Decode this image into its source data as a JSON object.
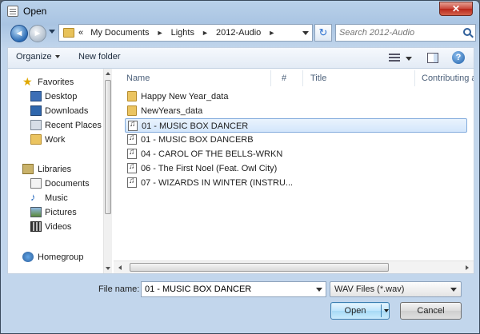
{
  "window": {
    "title": "Open",
    "close_label": "✕"
  },
  "nav": {
    "back_glyph": "◄",
    "forward_glyph": "►",
    "breadcrumb": [
      "«",
      "My Documents",
      "Lights",
      "2012-Audio"
    ],
    "breadcrumb_separator": "►",
    "refresh_glyph": "↻",
    "search_placeholder": "Search 2012-Audio"
  },
  "toolbar": {
    "organize_label": "Organize",
    "new_folder_label": "New folder",
    "help_glyph": "?"
  },
  "sidebar": {
    "items": [
      {
        "label": "Favorites",
        "icon": "star-icon",
        "level": 0
      },
      {
        "label": "Desktop",
        "icon": "desktop-icon",
        "level": 1
      },
      {
        "label": "Downloads",
        "icon": "downloads-icon",
        "level": 1
      },
      {
        "label": "Recent Places",
        "icon": "recent-places-icon",
        "level": 1
      },
      {
        "label": "Work",
        "icon": "folder-icon",
        "level": 1
      },
      {
        "label": "Libraries",
        "icon": "libraries-icon",
        "level": 0
      },
      {
        "label": "Documents",
        "icon": "documents-icon",
        "level": 1
      },
      {
        "label": "Music",
        "icon": "music-icon",
        "level": 1
      },
      {
        "label": "Pictures",
        "icon": "pictures-icon",
        "level": 1
      },
      {
        "label": "Videos",
        "icon": "videos-icon",
        "level": 1
      },
      {
        "label": "Homegroup",
        "icon": "homegroup-icon",
        "level": 0
      }
    ]
  },
  "file_list": {
    "columns": [
      "Name",
      "#",
      "Title",
      "Contributing a"
    ],
    "items": [
      {
        "name": "Happy New Year_data",
        "type": "folder",
        "selected": false
      },
      {
        "name": "NewYears_data",
        "type": "folder",
        "selected": false
      },
      {
        "name": "01 - MUSIC BOX DANCER",
        "type": "audio",
        "selected": true
      },
      {
        "name": "01 - MUSIC BOX DANCERB",
        "type": "audio",
        "selected": false
      },
      {
        "name": "04 - CAROL OF THE BELLS-WRKN",
        "type": "audio",
        "selected": false
      },
      {
        "name": "06 - The First Noel (Feat. Owl City)",
        "type": "audio",
        "selected": false
      },
      {
        "name": "07 - WIZARDS IN WINTER (INSTRU...",
        "type": "audio",
        "selected": false
      }
    ]
  },
  "footer": {
    "file_name_label": "File name:",
    "file_name_value": "01 - MUSIC BOX DANCER",
    "file_type_selected": "WAV Files (*.wav)",
    "open_label": "Open",
    "cancel_label": "Cancel"
  },
  "colors": {
    "accent": "#3c7fb1",
    "selection": "#d3e6fb"
  }
}
